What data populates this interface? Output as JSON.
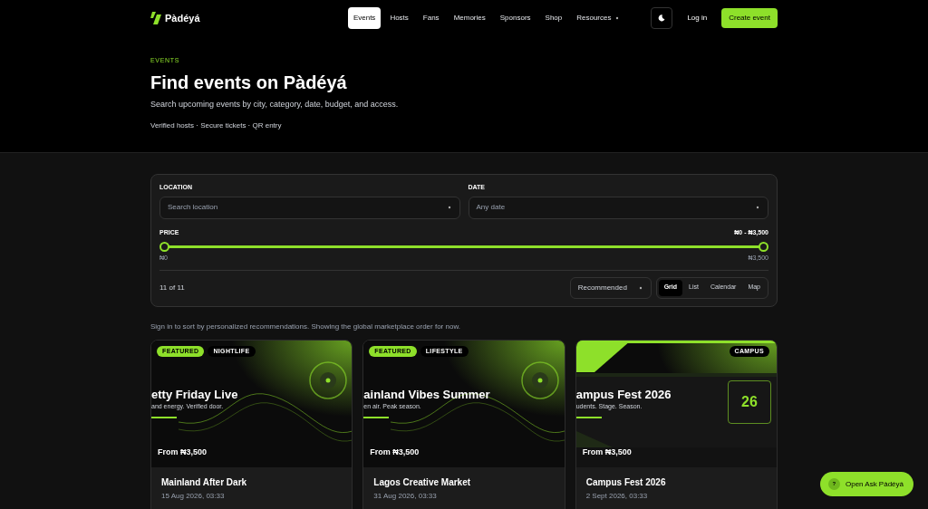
{
  "nav": {
    "logo": "Pàdéyá",
    "links": [
      {
        "label": "Events",
        "selected": true
      },
      {
        "label": "Hosts",
        "selected": false
      },
      {
        "label": "Fans",
        "selected": false
      },
      {
        "label": "Memories",
        "selected": false
      },
      {
        "label": "Sponsors",
        "selected": false
      },
      {
        "label": "Shop",
        "selected": false
      },
      {
        "label": "Resources",
        "selected": false,
        "dropdown": true
      }
    ],
    "login": "Log in",
    "cta": "Create event"
  },
  "hero": {
    "eyebrow": "EVENTS",
    "title": "Find events on Pàdéyá",
    "subtitle": "Search upcoming events by city, category, date, budget, and access.",
    "trust": "Verified hosts · Secure tickets · QR entry"
  },
  "filters": {
    "location": {
      "label": "LOCATION",
      "placeholder": "Search location"
    },
    "date": {
      "label": "DATE",
      "placeholder": "Any date"
    },
    "price": {
      "label": "PRICE",
      "reading": "₦0 - ₦3,500",
      "min": "₦0",
      "max": "₦3,500",
      "thumbs": [
        {
          "level": 0
        },
        {
          "level": 1
        }
      ]
    },
    "count": "11 of 11",
    "sort": "Recommended",
    "views": [
      {
        "label": "Grid",
        "selected": true
      },
      {
        "label": "List",
        "selected": false
      },
      {
        "label": "Calendar",
        "selected": false
      },
      {
        "label": "Map",
        "selected": false
      }
    ]
  },
  "notice": "Sign in to sort by personalized recommendations. Showing the global marketplace order for now.",
  "events": [
    {
      "kind": "disc",
      "tags": [
        {
          "label": "FEATURED",
          "featured": true
        },
        {
          "label": "NIGHTLIFE",
          "featured": false
        }
      ],
      "poster_title": "etty Friday Live",
      "poster_subtitle": "and energy. Verified door.",
      "price": "From ₦3,500",
      "title": "Mainland After Dark",
      "date": "15 Aug 2026, 03:33"
    },
    {
      "kind": "disc",
      "tags": [
        {
          "label": "FEATURED",
          "featured": true
        },
        {
          "label": "LIFESTYLE",
          "featured": false
        }
      ],
      "poster_title": "ainland Vibes Summer",
      "poster_subtitle": "en air. Peak season.",
      "price": "From ₦3,500",
      "title": "Lagos Creative Market",
      "date": "31 Aug 2026, 03:33"
    },
    {
      "kind": "calendar",
      "day": "26",
      "tags": [
        {
          "label": "CAMPUS",
          "featured": false
        }
      ],
      "poster_title": "ampus Fest 2026",
      "poster_subtitle": "udents. Stage. Season.",
      "price": "From ₦3,500",
      "title": "Campus Fest 2026",
      "date": "2 Sept 2026, 03:33"
    }
  ],
  "assistant": {
    "icon_label": "?",
    "label": "Open Ask Pàdéyá"
  }
}
